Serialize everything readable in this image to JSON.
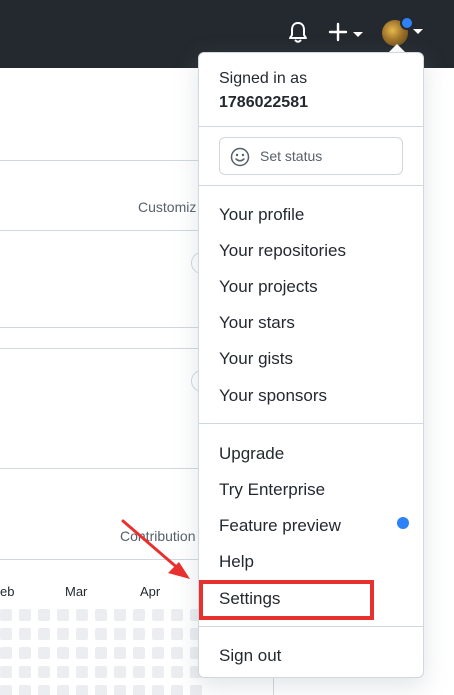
{
  "header": {
    "icons": [
      "bell-icon",
      "plus-icon",
      "avatar"
    ],
    "colors": {
      "bar": "#24292f",
      "notification_dot": "#2f81f7"
    }
  },
  "background": {
    "customize_label": "Customiz",
    "contribution_label": "Contribution",
    "months": [
      "eb",
      "Mar",
      "Apr"
    ]
  },
  "dropdown": {
    "signed_in_label": "Signed in as",
    "username": "1786022581",
    "status_button": "Set status",
    "items": [
      "Your profile",
      "Your repositories",
      "Your projects",
      "Your stars",
      "Your gists",
      "Your sponsors",
      "Upgrade",
      "Try Enterprise",
      "Feature preview",
      "Help",
      "Settings",
      "Sign out"
    ]
  },
  "annotation": {
    "highlight_color": "#e8312f"
  }
}
